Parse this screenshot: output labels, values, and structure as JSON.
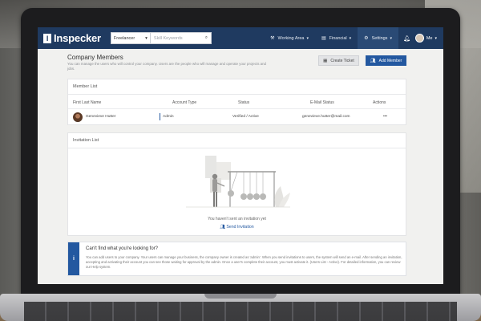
{
  "colors": {
    "nav_bg": "#1f3a60",
    "accent": "#2358a0",
    "page_bg": "#f1f1ef"
  },
  "topnav": {
    "logo": "Inspecker",
    "logo_icon": "logo-i-icon",
    "search_type": "Freelancer",
    "search_placeholder": "Skill Keywords",
    "items": [
      {
        "label": "Working Area",
        "icon": "toolbox-icon"
      },
      {
        "label": "Financial",
        "icon": "wallet-icon"
      },
      {
        "label": "Settings",
        "icon": "gear-icon"
      }
    ],
    "user_label": "Me"
  },
  "page": {
    "title": "Company Members",
    "description": "You can manage the users who will control your company. Users are the people who will manage and operate your projects and jobs.",
    "create_ticket_label": "Create Ticket",
    "add_member_label": "Add Member"
  },
  "member_list": {
    "title": "Member List",
    "columns": [
      "First Last Name",
      "Account Type",
      "Status",
      "E-Mail Status",
      "Actions"
    ],
    "rows": [
      {
        "name": "Genevieve Hutter",
        "account_type": "Admin",
        "status": "Verified / Active",
        "email": "genevieve.hutter@mail.com",
        "actions": "•••"
      }
    ]
  },
  "invitation_list": {
    "title": "Invitation List",
    "empty_text": "You haven't sent an invitation yet",
    "send_label": "Send Invitation"
  },
  "info": {
    "icon": "i",
    "title": "Can't find what you're looking for?",
    "text": "You can add users to your company. Your users can manage your business, the company owner is created as 'admin'. When you send invitations to users, the system will send an e-mail. After sending an invitation, accepting and activating their account you can see those waiting for approval by the admin. Once a user's complete their account, you must activate it. (Users List - Active). For detailed information, you can review our Help system."
  }
}
